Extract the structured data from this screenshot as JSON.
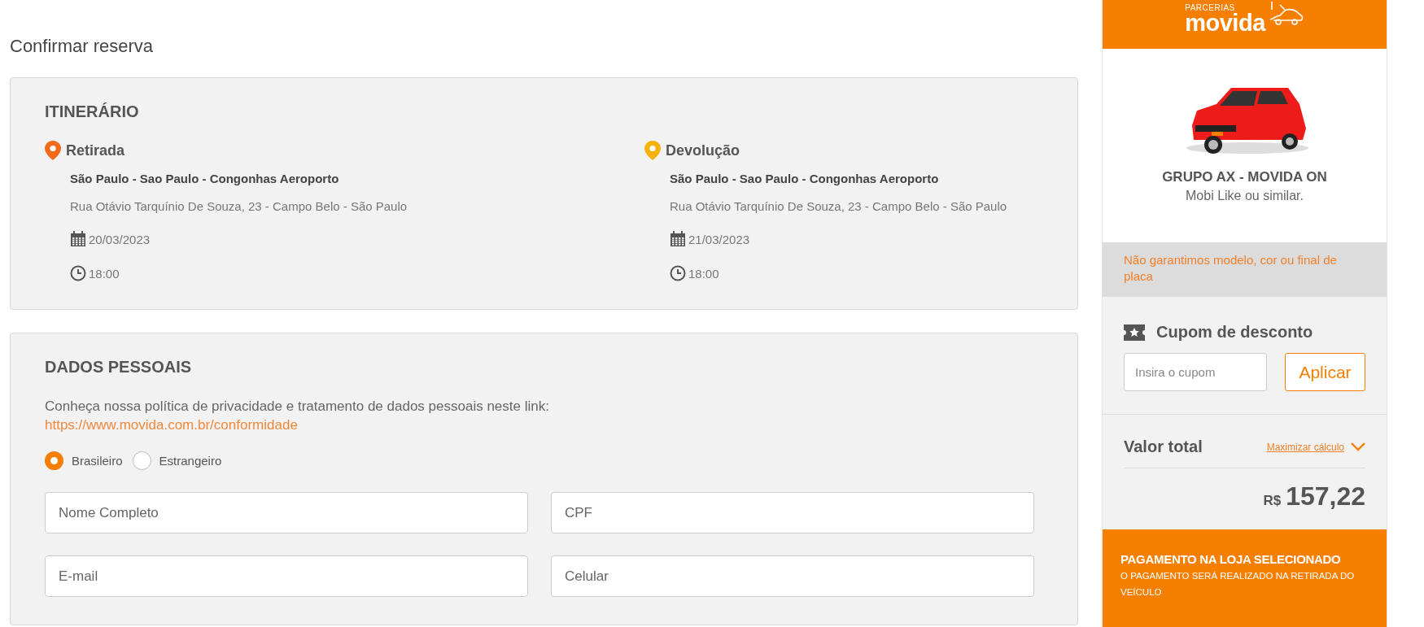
{
  "page_title": "Confirmar reserva",
  "itinerary": {
    "title": "ITINERÁRIO",
    "stops": [
      {
        "label": "Retirada",
        "color": "#f26b1d",
        "location": "São Paulo - Sao Paulo - Congonhas Aeroporto",
        "address": "Rua Otávio Tarquínio De Souza, 23 - Campo Belo - São Paulo",
        "date": "20/03/2023",
        "time": "18:00"
      },
      {
        "label": "Devolução",
        "color": "#f5b20a",
        "location": "São Paulo - Sao Paulo - Congonhas Aeroporto",
        "address": "Rua Otávio Tarquínio De Souza, 23 - Campo Belo - São Paulo",
        "date": "21/03/2023",
        "time": "18:00"
      }
    ]
  },
  "personal_data": {
    "title": "DADOS PESSOAIS",
    "privacy_text": "Conheça nossa política de privacidade e tratamento de dados pessoais neste link:",
    "privacy_link": "https://www.movida.com.br/conformidade",
    "nationality": [
      {
        "label": "Brasileiro",
        "selected": true
      },
      {
        "label": "Estrangeiro",
        "selected": false
      }
    ],
    "fields": [
      {
        "placeholder": "Nome Completo"
      },
      {
        "placeholder": "CPF"
      },
      {
        "placeholder": "E-mail"
      },
      {
        "placeholder": "Celular"
      }
    ]
  },
  "sidebar": {
    "logo": {
      "tagline": "PARCERIAS",
      "brand": "movida"
    },
    "vehicle": {
      "group": "GRUPO AX - MOVIDA ON",
      "model": "Mobi Like ou similar."
    },
    "notice": "Não garantimos modelo, cor ou final de placa",
    "coupon": {
      "title": "Cupom de desconto",
      "placeholder": "Insira o cupom",
      "button": "Aplicar"
    },
    "total": {
      "label": "Valor total",
      "link": "Maximizar cálculo",
      "expanded": false,
      "currency": "R$",
      "amount": "157,22"
    },
    "payment": {
      "title": "PAGAMENTO NA LOJA SELECIONADO",
      "subtitle": "O PAGAMENTO SERÁ REALIZADO NA RETIRADA DO VEÍCULO"
    }
  }
}
